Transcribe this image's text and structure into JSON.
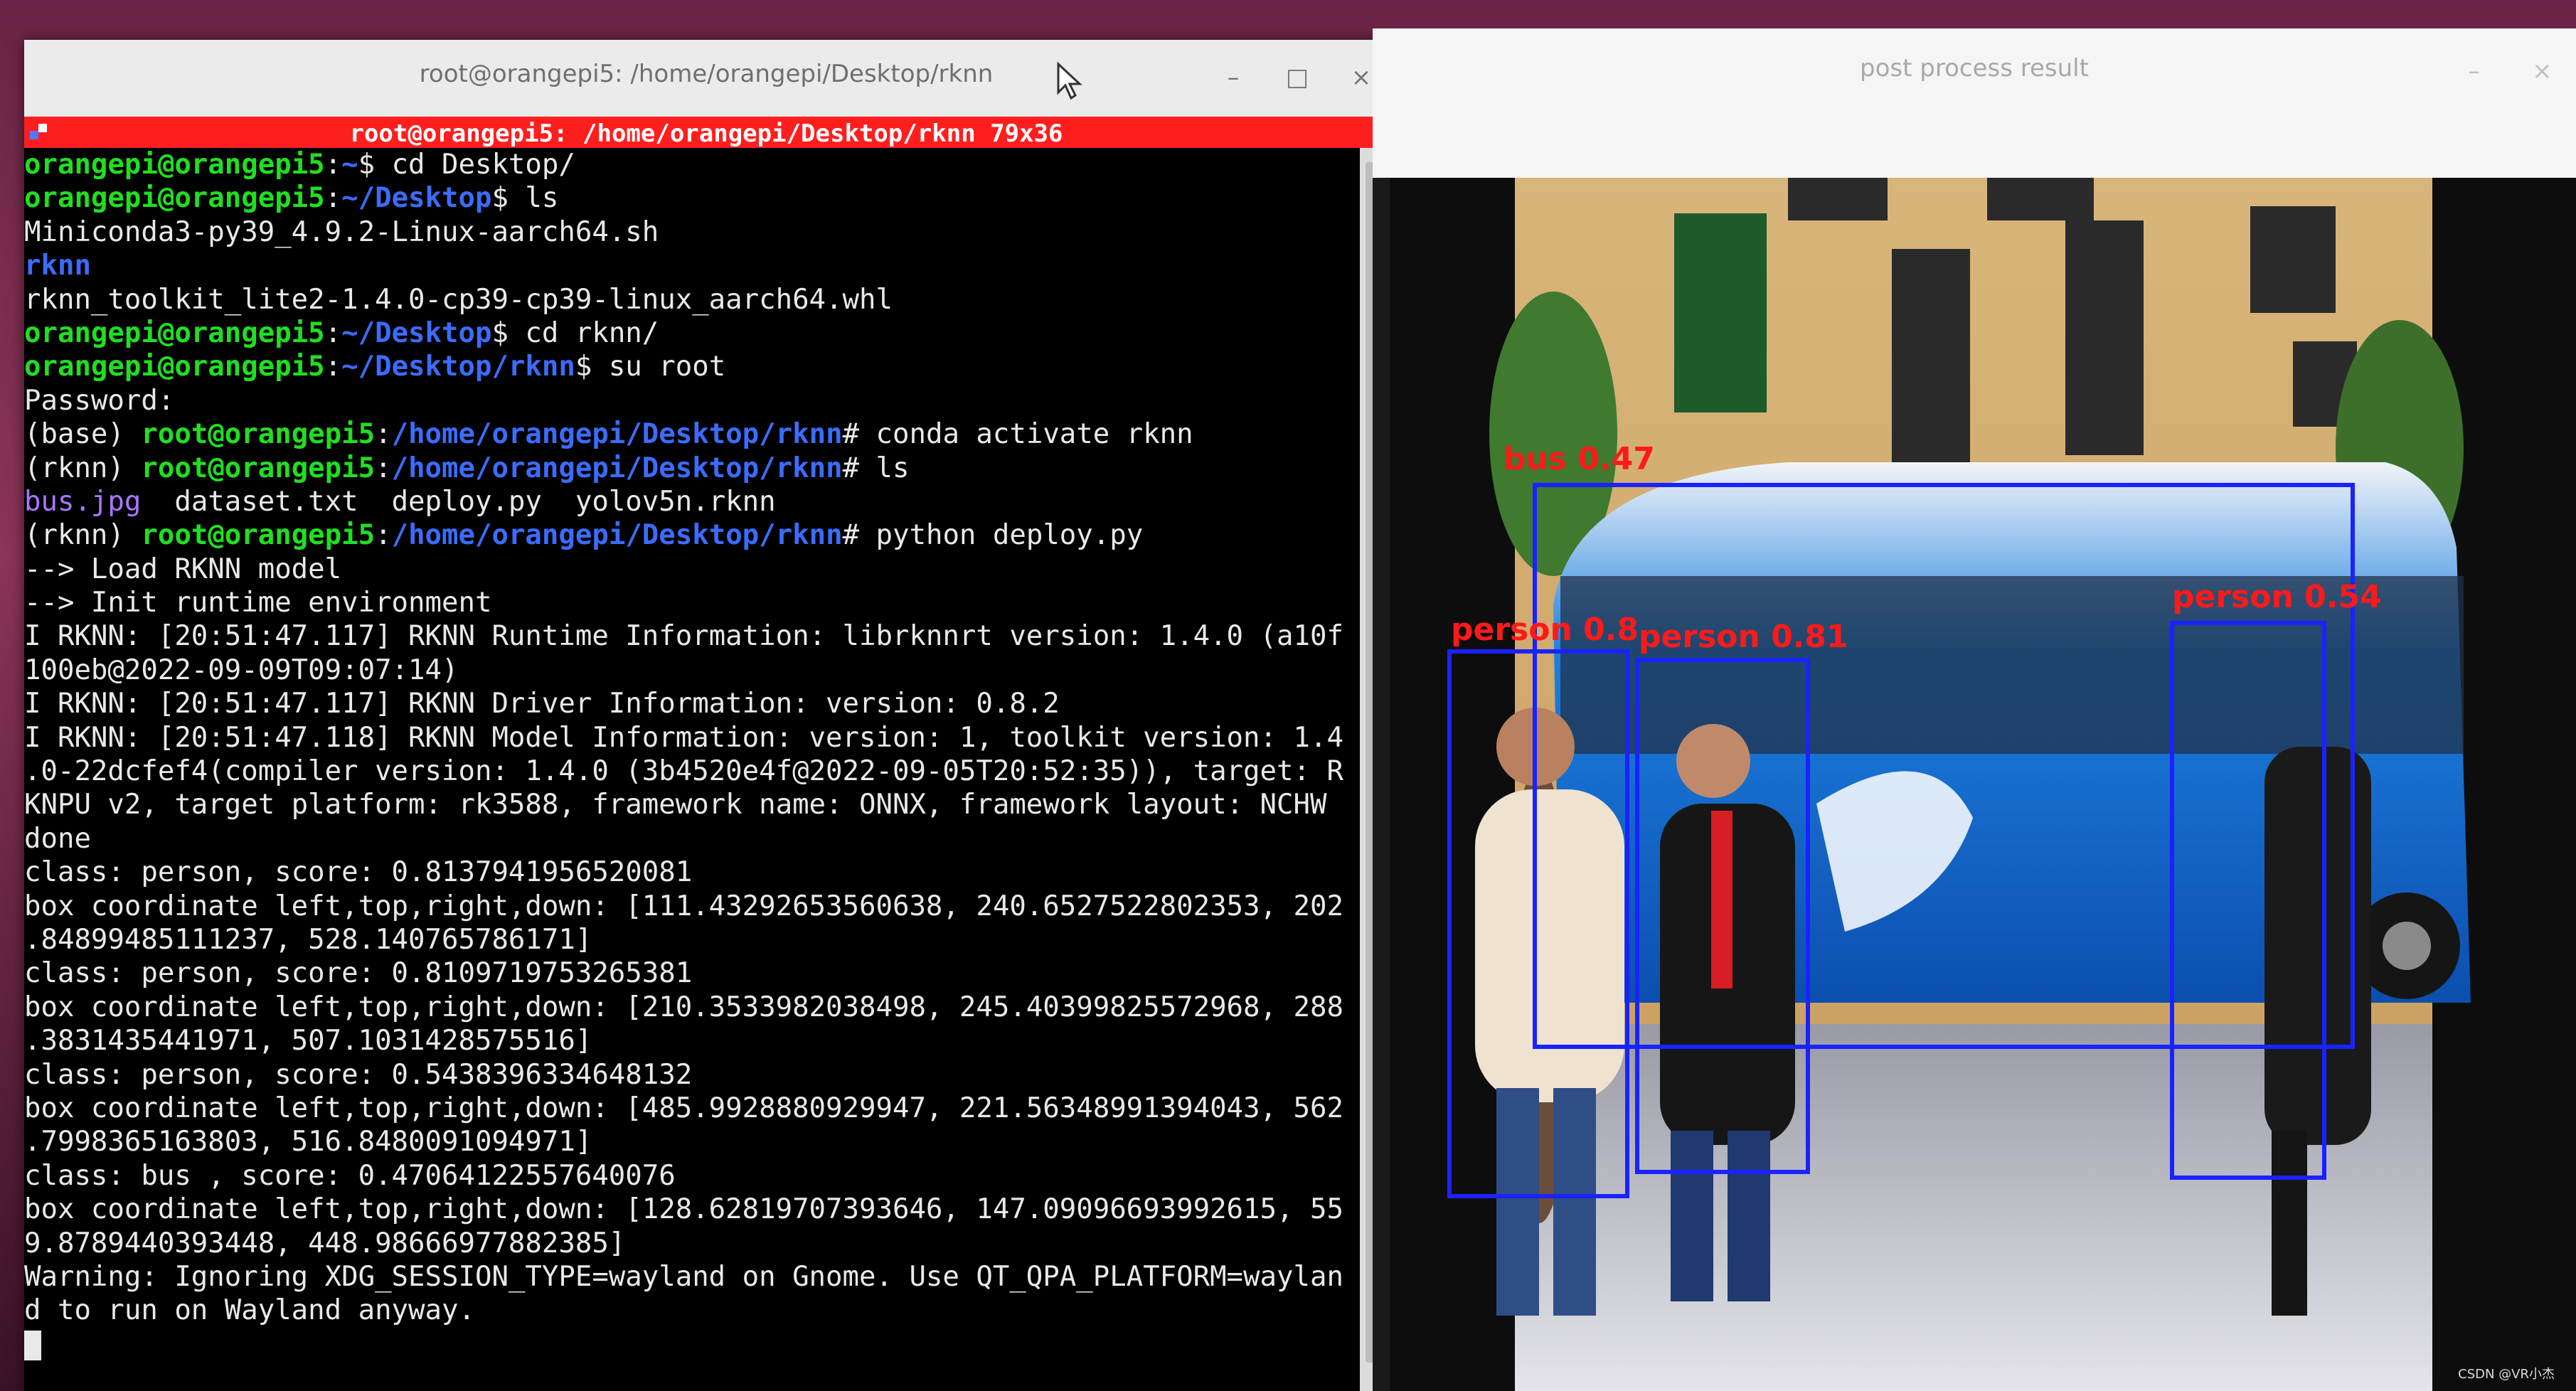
{
  "terminal": {
    "window_title": "root@orangepi5: /home/orangepi/Desktop/rknn",
    "tab_title": "root@orangepi5: /home/orangepi/Desktop/rknn 79x36",
    "minimize": "–",
    "maximize": "□",
    "close": "×",
    "lines": [
      [
        {
          "t": "orangepi@orangepi5",
          "c": "g"
        },
        {
          "t": ":",
          "c": "w"
        },
        {
          "t": "~",
          "c": "b"
        },
        {
          "t": "$ cd Desktop/",
          "c": "w"
        }
      ],
      [
        {
          "t": "orangepi@orangepi5",
          "c": "g"
        },
        {
          "t": ":",
          "c": "w"
        },
        {
          "t": "~/Desktop",
          "c": "b"
        },
        {
          "t": "$ ls",
          "c": "w"
        }
      ],
      [
        {
          "t": "Miniconda3-py39_4.9.2-Linux-aarch64.sh",
          "c": "w"
        }
      ],
      [
        {
          "t": "rknn",
          "c": "b"
        }
      ],
      [
        {
          "t": "rknn_toolkit_lite2-1.4.0-cp39-cp39-linux_aarch64.whl",
          "c": "w"
        }
      ],
      [
        {
          "t": "orangepi@orangepi5",
          "c": "g"
        },
        {
          "t": ":",
          "c": "w"
        },
        {
          "t": "~/Desktop",
          "c": "b"
        },
        {
          "t": "$ cd rknn/",
          "c": "w"
        }
      ],
      [
        {
          "t": "orangepi@orangepi5",
          "c": "g"
        },
        {
          "t": ":",
          "c": "w"
        },
        {
          "t": "~/Desktop/rknn",
          "c": "b"
        },
        {
          "t": "$ su root",
          "c": "w"
        }
      ],
      [
        {
          "t": "Password:",
          "c": "w"
        }
      ],
      [
        {
          "t": "(base) ",
          "c": "w"
        },
        {
          "t": "root@orangepi5",
          "c": "g"
        },
        {
          "t": ":",
          "c": "w"
        },
        {
          "t": "/home/orangepi/Desktop/rknn",
          "c": "b"
        },
        {
          "t": "# conda activate rknn",
          "c": "w"
        }
      ],
      [
        {
          "t": "(rknn) ",
          "c": "w"
        },
        {
          "t": "root@orangepi5",
          "c": "g"
        },
        {
          "t": ":",
          "c": "w"
        },
        {
          "t": "/home/orangepi/Desktop/rknn",
          "c": "b"
        },
        {
          "t": "# ls",
          "c": "w"
        }
      ],
      [
        {
          "t": "bus.jpg",
          "c": "m"
        },
        {
          "t": "  dataset.txt  deploy.py  yolov5n.rknn",
          "c": "w"
        }
      ],
      [
        {
          "t": "(rknn) ",
          "c": "w"
        },
        {
          "t": "root@orangepi5",
          "c": "g"
        },
        {
          "t": ":",
          "c": "w"
        },
        {
          "t": "/home/orangepi/Desktop/rknn",
          "c": "b"
        },
        {
          "t": "# python deploy.py",
          "c": "w"
        }
      ],
      [
        {
          "t": "--> Load RKNN model",
          "c": "w"
        }
      ],
      [
        {
          "t": "--> Init runtime environment",
          "c": "w"
        }
      ],
      [
        {
          "t": "I RKNN: [20:51:47.117] RKNN Runtime Information: librknnrt version: 1.4.0 (a10f",
          "c": "w"
        }
      ],
      [
        {
          "t": "100eb@2022-09-09T09:07:14)",
          "c": "w"
        }
      ],
      [
        {
          "t": "I RKNN: [20:51:47.117] RKNN Driver Information: version: 0.8.2",
          "c": "w"
        }
      ],
      [
        {
          "t": "I RKNN: [20:51:47.118] RKNN Model Information: version: 1, toolkit version: 1.4",
          "c": "w"
        }
      ],
      [
        {
          "t": ".0-22dcfef4(compiler version: 1.4.0 (3b4520e4f@2022-09-05T20:52:35)), target: R",
          "c": "w"
        }
      ],
      [
        {
          "t": "KNPU v2, target platform: rk3588, framework name: ONNX, framework layout: NCHW",
          "c": "w"
        }
      ],
      [
        {
          "t": "done",
          "c": "w"
        }
      ],
      [
        {
          "t": "class: person, score: 0.8137941956520081",
          "c": "w"
        }
      ],
      [
        {
          "t": "box coordinate left,top,right,down: [111.43292653560638, 240.6527522802353, 202",
          "c": "w"
        }
      ],
      [
        {
          "t": ".84899485111237, 528.140765786171]",
          "c": "w"
        }
      ],
      [
        {
          "t": "class: person, score: 0.8109719753265381",
          "c": "w"
        }
      ],
      [
        {
          "t": "box coordinate left,top,right,down: [210.3533982038498, 245.40399825572968, 288",
          "c": "w"
        }
      ],
      [
        {
          "t": ".3831435441971, 507.1031428575516]",
          "c": "w"
        }
      ],
      [
        {
          "t": "class: person, score: 0.5438396334648132",
          "c": "w"
        }
      ],
      [
        {
          "t": "box coordinate left,top,right,down: [485.9928880929947, 221.56348991394043, 562",
          "c": "w"
        }
      ],
      [
        {
          "t": ".7998365163803, 516.8480091094971]",
          "c": "w"
        }
      ],
      [
        {
          "t": "class: bus , score: 0.47064122557640076",
          "c": "w"
        }
      ],
      [
        {
          "t": "box coordinate left,top,right,down: [128.62819707393646, 147.09096693992615, 55",
          "c": "w"
        }
      ],
      [
        {
          "t": "9.8789440393448, 448.98666977882385]",
          "c": "w"
        }
      ],
      [
        {
          "t": "Warning: Ignoring XDG_SESSION_TYPE=wayland on Gnome. Use QT_QPA_PLATFORM=waylan",
          "c": "w"
        }
      ],
      [
        {
          "t": "d to run on Wayland anyway.",
          "c": "w"
        }
      ]
    ]
  },
  "result_window": {
    "title": "post process result",
    "minimize": "–",
    "close": "×",
    "box_color": "#1a22ff",
    "label_color": "#ff1a1a",
    "detections": [
      {
        "label": "bus  0.47",
        "class": "bus",
        "score": 0.47
      },
      {
        "label": "person  0.81",
        "class": "person",
        "score": 0.81,
        "shown_as": "person 0.8"
      },
      {
        "label": "person  0.81",
        "class": "person",
        "score": 0.81
      },
      {
        "label": "person  0.54",
        "class": "person",
        "score": 0.54
      }
    ],
    "watermark": "CSDN @VR小杰"
  }
}
